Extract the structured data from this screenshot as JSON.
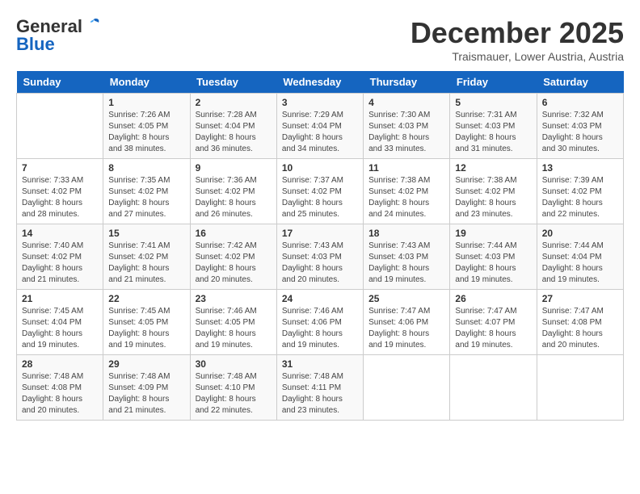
{
  "header": {
    "logo_general": "General",
    "logo_blue": "Blue",
    "month": "December 2025",
    "location": "Traismauer, Lower Austria, Austria"
  },
  "days_of_week": [
    "Sunday",
    "Monday",
    "Tuesday",
    "Wednesday",
    "Thursday",
    "Friday",
    "Saturday"
  ],
  "weeks": [
    [
      {
        "num": "",
        "info": ""
      },
      {
        "num": "1",
        "info": "Sunrise: 7:26 AM\nSunset: 4:05 PM\nDaylight: 8 hours\nand 38 minutes."
      },
      {
        "num": "2",
        "info": "Sunrise: 7:28 AM\nSunset: 4:04 PM\nDaylight: 8 hours\nand 36 minutes."
      },
      {
        "num": "3",
        "info": "Sunrise: 7:29 AM\nSunset: 4:04 PM\nDaylight: 8 hours\nand 34 minutes."
      },
      {
        "num": "4",
        "info": "Sunrise: 7:30 AM\nSunset: 4:03 PM\nDaylight: 8 hours\nand 33 minutes."
      },
      {
        "num": "5",
        "info": "Sunrise: 7:31 AM\nSunset: 4:03 PM\nDaylight: 8 hours\nand 31 minutes."
      },
      {
        "num": "6",
        "info": "Sunrise: 7:32 AM\nSunset: 4:03 PM\nDaylight: 8 hours\nand 30 minutes."
      }
    ],
    [
      {
        "num": "7",
        "info": "Sunrise: 7:33 AM\nSunset: 4:02 PM\nDaylight: 8 hours\nand 28 minutes."
      },
      {
        "num": "8",
        "info": "Sunrise: 7:35 AM\nSunset: 4:02 PM\nDaylight: 8 hours\nand 27 minutes."
      },
      {
        "num": "9",
        "info": "Sunrise: 7:36 AM\nSunset: 4:02 PM\nDaylight: 8 hours\nand 26 minutes."
      },
      {
        "num": "10",
        "info": "Sunrise: 7:37 AM\nSunset: 4:02 PM\nDaylight: 8 hours\nand 25 minutes."
      },
      {
        "num": "11",
        "info": "Sunrise: 7:38 AM\nSunset: 4:02 PM\nDaylight: 8 hours\nand 24 minutes."
      },
      {
        "num": "12",
        "info": "Sunrise: 7:38 AM\nSunset: 4:02 PM\nDaylight: 8 hours\nand 23 minutes."
      },
      {
        "num": "13",
        "info": "Sunrise: 7:39 AM\nSunset: 4:02 PM\nDaylight: 8 hours\nand 22 minutes."
      }
    ],
    [
      {
        "num": "14",
        "info": "Sunrise: 7:40 AM\nSunset: 4:02 PM\nDaylight: 8 hours\nand 21 minutes."
      },
      {
        "num": "15",
        "info": "Sunrise: 7:41 AM\nSunset: 4:02 PM\nDaylight: 8 hours\nand 21 minutes."
      },
      {
        "num": "16",
        "info": "Sunrise: 7:42 AM\nSunset: 4:02 PM\nDaylight: 8 hours\nand 20 minutes."
      },
      {
        "num": "17",
        "info": "Sunrise: 7:43 AM\nSunset: 4:03 PM\nDaylight: 8 hours\nand 20 minutes."
      },
      {
        "num": "18",
        "info": "Sunrise: 7:43 AM\nSunset: 4:03 PM\nDaylight: 8 hours\nand 19 minutes."
      },
      {
        "num": "19",
        "info": "Sunrise: 7:44 AM\nSunset: 4:03 PM\nDaylight: 8 hours\nand 19 minutes."
      },
      {
        "num": "20",
        "info": "Sunrise: 7:44 AM\nSunset: 4:04 PM\nDaylight: 8 hours\nand 19 minutes."
      }
    ],
    [
      {
        "num": "21",
        "info": "Sunrise: 7:45 AM\nSunset: 4:04 PM\nDaylight: 8 hours\nand 19 minutes."
      },
      {
        "num": "22",
        "info": "Sunrise: 7:45 AM\nSunset: 4:05 PM\nDaylight: 8 hours\nand 19 minutes."
      },
      {
        "num": "23",
        "info": "Sunrise: 7:46 AM\nSunset: 4:05 PM\nDaylight: 8 hours\nand 19 minutes."
      },
      {
        "num": "24",
        "info": "Sunrise: 7:46 AM\nSunset: 4:06 PM\nDaylight: 8 hours\nand 19 minutes."
      },
      {
        "num": "25",
        "info": "Sunrise: 7:47 AM\nSunset: 4:06 PM\nDaylight: 8 hours\nand 19 minutes."
      },
      {
        "num": "26",
        "info": "Sunrise: 7:47 AM\nSunset: 4:07 PM\nDaylight: 8 hours\nand 19 minutes."
      },
      {
        "num": "27",
        "info": "Sunrise: 7:47 AM\nSunset: 4:08 PM\nDaylight: 8 hours\nand 20 minutes."
      }
    ],
    [
      {
        "num": "28",
        "info": "Sunrise: 7:48 AM\nSunset: 4:08 PM\nDaylight: 8 hours\nand 20 minutes."
      },
      {
        "num": "29",
        "info": "Sunrise: 7:48 AM\nSunset: 4:09 PM\nDaylight: 8 hours\nand 21 minutes."
      },
      {
        "num": "30",
        "info": "Sunrise: 7:48 AM\nSunset: 4:10 PM\nDaylight: 8 hours\nand 22 minutes."
      },
      {
        "num": "31",
        "info": "Sunrise: 7:48 AM\nSunset: 4:11 PM\nDaylight: 8 hours\nand 23 minutes."
      },
      {
        "num": "",
        "info": ""
      },
      {
        "num": "",
        "info": ""
      },
      {
        "num": "",
        "info": ""
      }
    ]
  ]
}
